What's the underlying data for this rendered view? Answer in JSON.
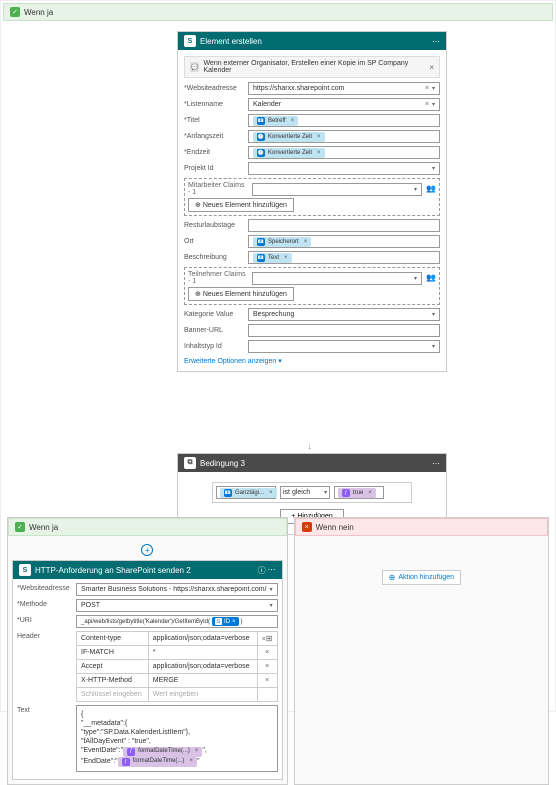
{
  "outer": {
    "label": "Wenn ja"
  },
  "create": {
    "title": "Element erstellen",
    "comment": "Wenn externer Organisator, Erstellen einer Kopie im SP Company Kalender",
    "fields": {
      "site_label": "*Websiteadresse",
      "site_value": "https://sharxx.sharepoint.com",
      "list_label": "*Listenname",
      "list_value": "Kalender",
      "title_label": "*Titel",
      "title_token": "Betreff",
      "start_label": "*Anfangszeit",
      "start_token": "Konvertierte Zeit",
      "end_label": "*Endzeit",
      "end_token": "Konvertierte Zeit",
      "project_label": "Projekt Id",
      "emp_claims_label": "Mitarbeiter Claims - 1",
      "add_item": "Neues Element hinzufügen",
      "vacation_label": "Resturlaubstage",
      "location_label": "Ort",
      "location_token": "Speicherort",
      "desc_label": "Beschreibung",
      "desc_token": "Text",
      "part_claims_label": "Teilnehmer Claims - 1",
      "category_label": "Kategorie Value",
      "category_value": "Besprechung",
      "banner_label": "Banner-URL",
      "contenttype_label": "Inhaltstyp Id",
      "advanced": "Erweiterte Optionen anzeigen"
    }
  },
  "condition": {
    "title": "Bedingung 3",
    "left_token": "Ganztägi...",
    "operator": "ist gleich",
    "right_token": "true",
    "add_btn": "Hinzufügen"
  },
  "branch_yes": {
    "label": "Wenn ja"
  },
  "branch_no": {
    "label": "Wenn nein",
    "add_action": "Aktion hinzufügen"
  },
  "http": {
    "title": "HTTP-Anforderung an SharePoint senden 2",
    "site_label": "*Websiteadresse",
    "site_value": "Smarter Business Solutions - https://sharxx.sharepoint.com/",
    "method_label": "*Methode",
    "method_value": "POST",
    "uri_label": "*URI",
    "uri_value": "_api/web/lists/getbytitle('Kalender')/GetItemById(",
    "uri_token": "ID",
    "headers_label": "Header",
    "headers": [
      {
        "k": "Content-type",
        "v": "application/json;odata=verbose"
      },
      {
        "k": "IF-MATCH",
        "v": "*"
      },
      {
        "k": "Accept",
        "v": "application/json;odata=verbose"
      },
      {
        "k": "X-HTTP-Method",
        "v": "MERGE"
      },
      {
        "k": "Schlüssel eingeben",
        "v": "Wert eingeben"
      }
    ],
    "body_label": "Text",
    "body_lines": [
      "{",
      "\"__metadata\":{",
      "\"type\":\"SP.Data.KalenderListItem\"},",
      "\"fAllDayEvent\" : \"true\",",
      "\"EventDate\":\"",
      "\"EndDate\":\""
    ],
    "body_token1": "formatDateTime(...)",
    "body_token2": "formatDateTime(...)"
  }
}
